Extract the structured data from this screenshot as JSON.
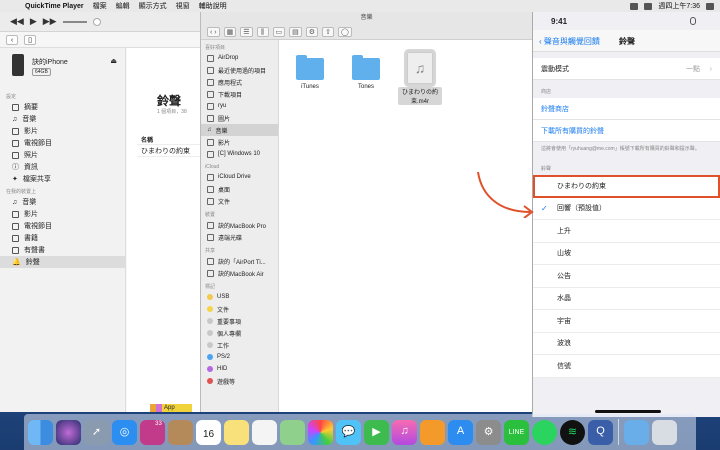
{
  "menubar": {
    "app_name": "QuickTime Player",
    "items": [
      "檔案",
      "編輯",
      "顯示方式",
      "視窗",
      "輔助說明"
    ],
    "clock": "週四上午7:36"
  },
  "itunes": {
    "device_name": "訣的iPhone",
    "capacity": "64GB",
    "settings_header": "設定",
    "settings_items": [
      "摘要",
      "音樂",
      "影片",
      "電視節目",
      "照片",
      "資訊",
      "檔案共享"
    ],
    "ondevice_header": "在我的裝置上",
    "ondevice_items": [
      "音樂",
      "影片",
      "電視節目",
      "書籍",
      "有聲書",
      "鈴聲"
    ],
    "selected_item": "鈴聲",
    "main_title": "鈴聲",
    "main_subtitle": "1 個項目，38",
    "column_header": "名稱",
    "rows": [
      "ひまわりの約束"
    ],
    "storage_label": "App"
  },
  "finder": {
    "window_title": "音樂",
    "favorites_header": "喜好項目",
    "favorites": [
      "AirDrop",
      "最近使用過的項目",
      "應用程式",
      "下載項目",
      "ryu",
      "圖片",
      "音樂",
      "影片",
      "[C] Windows 10"
    ],
    "icloud_header": "iCloud",
    "icloud_items": [
      "iCloud Drive",
      "桌面",
      "文件"
    ],
    "devices_header": "裝置",
    "devices": [
      "訣的MacBook Pro",
      "遠端光碟"
    ],
    "shared_header": "共享",
    "shared": [
      "訣的「AirPort Ti...",
      "訣的MacBook Air"
    ],
    "tags_header": "標記",
    "tags": [
      "USB",
      "文件",
      "重要事項",
      "個人專欄",
      "工作",
      "PS/2",
      "HID",
      "遊戲等"
    ],
    "tag_colors": [
      "#f2c94c",
      "#f5d547",
      "#c8c8c8",
      "#c8c8c8",
      "#c8c8c8",
      "#4aa3f0",
      "#b469e3",
      "#e05353"
    ],
    "selected_item": "音樂",
    "files": [
      "iTunes",
      "Tones",
      "ひまわりの約束.m4r"
    ]
  },
  "phone": {
    "time": "9:41",
    "back_label": "聲音與觸覺回饋",
    "title": "鈴聲",
    "vibration_label": "震動模式",
    "vibration_value": "一點",
    "store_header": "商店",
    "store_link": "鈴聲商店",
    "download_link": "下載所有購買的鈴聲",
    "note": "這將會使用「ryuhuang@me.com」帳號下載所有購買的鈴聲和提示聲。",
    "ringtones_header": "鈴聲",
    "highlighted_tone": "ひまわりの約束",
    "tones": [
      "回響（預設值）",
      "上升",
      "山坡",
      "公告",
      "水晶",
      "宇宙",
      "波浪",
      "信號"
    ],
    "checked_tone": "回響（預設值）"
  },
  "dock": {
    "apps": [
      "finder-icon",
      "siri-icon",
      "launchpad-icon",
      "safari-icon",
      "photos-browser-icon",
      "contacts-icon",
      "calendar-icon",
      "notes-icon",
      "reminders-icon",
      "maps-icon",
      "photos-icon",
      "messages-icon",
      "facetime-icon",
      "itunes-icon",
      "books-icon",
      "app-store-icon",
      "system-preferences-icon",
      "line-icon",
      "whatsapp-icon",
      "spotify-icon",
      "quicktime-icon",
      "downloads-folder-icon",
      "trash-icon"
    ],
    "calendar_day": "16",
    "badge": "33"
  }
}
